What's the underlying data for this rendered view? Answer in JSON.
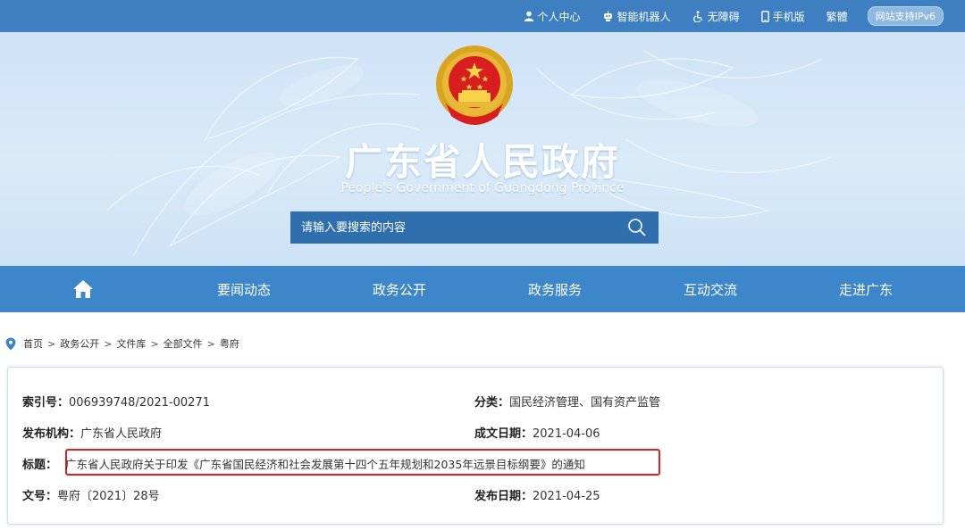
{
  "topbar": {
    "links": [
      {
        "label": "个人中心",
        "icon": "person-icon"
      },
      {
        "label": "智能机器人",
        "icon": "robot-icon"
      },
      {
        "label": "无障碍",
        "icon": "accessibility-icon"
      },
      {
        "label": "手机版",
        "icon": "mobile-icon"
      },
      {
        "label": "繁體",
        "icon": ""
      }
    ],
    "ipv6_badge": "网站支持IPv6"
  },
  "banner": {
    "title": "广东省人民政府",
    "subtitle": "People's Government of Guangdong Province",
    "search_placeholder": "请输入要搜索的内容"
  },
  "nav": {
    "home_icon": "home-icon",
    "items": [
      "要闻动态",
      "政务公开",
      "政务服务",
      "互动交流",
      "走进广东"
    ]
  },
  "breadcrumb": [
    "首页",
    "政务公开",
    "文件库",
    "全部文件",
    "粤府"
  ],
  "document": {
    "index_label": "索引号：",
    "index_value": "006939748/2021-00271",
    "category_label": "分类：",
    "category_value": "国民经济管理、国有资产监管",
    "issuer_label": "发布机构：",
    "issuer_value": "广东省人民政府",
    "created_label": "成文日期：",
    "created_value": "2021-04-06",
    "title_label": "标题：",
    "title_value": "广东省人民政府关于印发《广东省国民经济和社会发展第十四个五年规划和2035年远景目标纲要》的通知",
    "docno_label": "文号：",
    "docno_value": "粤府〔2021〕28号",
    "published_label": "发布日期：",
    "published_value": "2021-04-25"
  },
  "colors": {
    "topbar": "#3d7fc1",
    "nav": "#3c86c9",
    "search": "#2f6fae",
    "highlight_border": "#e02020"
  }
}
